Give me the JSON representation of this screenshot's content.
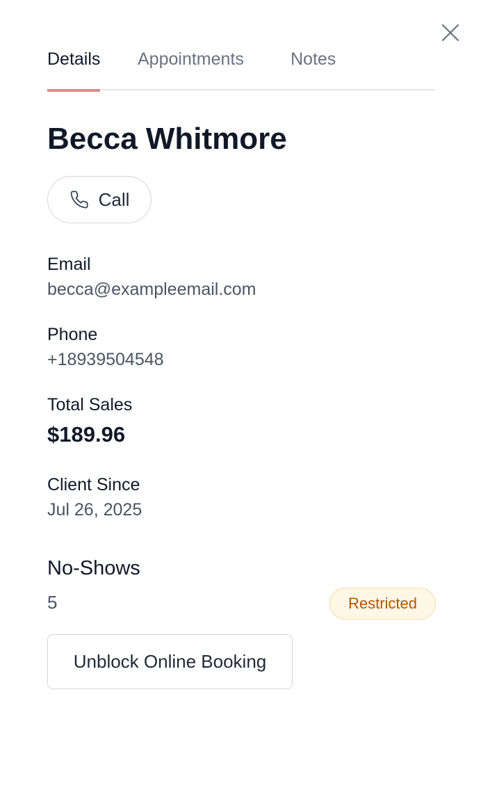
{
  "tabs": [
    {
      "label": "Details",
      "active": true
    },
    {
      "label": "Appointments",
      "active": false
    },
    {
      "label": "Notes",
      "active": false
    }
  ],
  "client": {
    "name": "Becca Whitmore"
  },
  "call_button": {
    "label": "Call",
    "icon": "phone-icon"
  },
  "fields": {
    "email_label": "Email",
    "email_value": "becca@exampleemail.com",
    "phone_label": "Phone",
    "phone_value": "+18939504548",
    "sales_label": "Total Sales",
    "sales_value": "$189.96",
    "since_label": "Client Since",
    "since_value": "Jul 26, 2025"
  },
  "no_shows": {
    "label": "No-Shows",
    "value": "5",
    "badge": "Restricted"
  },
  "unblock_button": {
    "label": "Unblock Online Booking"
  },
  "colors": {
    "active_tab_underline": "#d98a8a",
    "badge_bg": "#fff7e6",
    "badge_text": "#b45309",
    "badge_border": "#fcd9a8"
  }
}
